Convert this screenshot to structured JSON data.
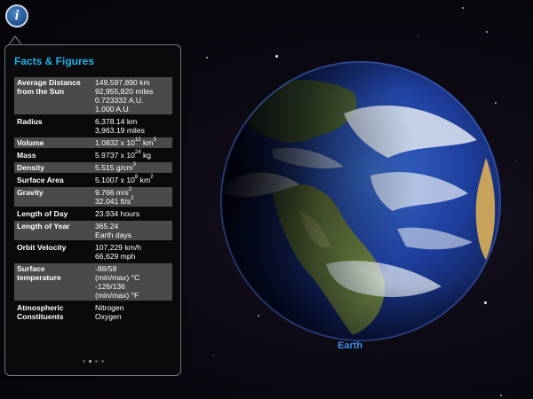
{
  "app": {
    "info_button": {
      "label": "i",
      "icon": "info-icon"
    }
  },
  "panel": {
    "title": "Facts & Figures",
    "facts": [
      {
        "label": [
          "Average Distance",
          "from the Sun"
        ],
        "values": [
          "149,597,890 km",
          "92,955,820 miles",
          "0.723332 A.U.",
          "1.000 A.U."
        ],
        "shaded": true
      },
      {
        "label": [
          "Radius"
        ],
        "values": [
          "6,378.14 km",
          "3,963.19 miles"
        ],
        "shaded": false
      },
      {
        "label": [
          "Volume"
        ],
        "values": [
          "1.0832 x 10^12 km^3"
        ],
        "shaded": true
      },
      {
        "label": [
          "Mass"
        ],
        "values": [
          "5.9737 x 10^24 kg"
        ],
        "shaded": false
      },
      {
        "label": [
          "Density"
        ],
        "values": [
          "5.515 g/cm^3"
        ],
        "shaded": true
      },
      {
        "label": [
          "Surface Area"
        ],
        "values": [
          "5.1007 x 10^8 km^2"
        ],
        "shaded": false
      },
      {
        "label": [
          "Gravity"
        ],
        "values": [
          "9.766 m/s^2",
          "32.041 ft/s^2"
        ],
        "shaded": true
      },
      {
        "label": [
          "Length of Day"
        ],
        "values": [
          "23.934 hours"
        ],
        "shaded": false
      },
      {
        "label": [
          "Length of Year"
        ],
        "values": [
          "365.24",
          "Earth days"
        ],
        "shaded": true
      },
      {
        "label": [
          "Orbit Velocity"
        ],
        "values": [
          "107,229 km/h",
          "66,629 mph"
        ],
        "shaded": false
      },
      {
        "label": [
          "Surface",
          "temperature"
        ],
        "values": [
          "-88/58",
          "(min/max) °C",
          "-126/136",
          "(min/max) °F"
        ],
        "shaded": true
      },
      {
        "label": [
          "Atmospheric",
          "Constituents"
        ],
        "values": [
          "Nitrogen",
          "Oxygen"
        ],
        "shaded": false
      }
    ],
    "page_dots": {
      "count": 4,
      "active_index": 1
    }
  },
  "planet": {
    "name": "Earth",
    "colors": {
      "label": "#3c8fe6",
      "ocean": "#1f3f9e",
      "land": "#5f7a3c",
      "cloud": "#e8eef6"
    }
  },
  "colors": {
    "accent": "#21b0e8",
    "panel_bg": "#0a0a0c",
    "row_shade": "#4a4a4a"
  }
}
